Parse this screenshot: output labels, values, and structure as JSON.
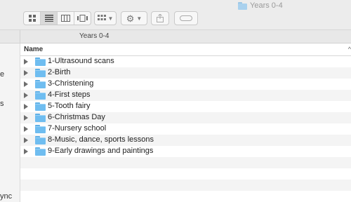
{
  "window": {
    "title": "Years 0-4",
    "title_icon": "folder-icon"
  },
  "toolbar": {
    "view_buttons": [
      {
        "icon": "icon-view-icon",
        "active": false
      },
      {
        "icon": "list-view-icon",
        "active": true
      },
      {
        "icon": "column-view-icon",
        "active": false
      },
      {
        "icon": "cover-flow-icon",
        "active": false
      }
    ],
    "arrange_icon": "arrange-grid-icon",
    "action_icon": "gear-icon",
    "share_icon": "share-icon",
    "tag_icon": "tag-icon"
  },
  "pathbar": {
    "label": "Years 0-4"
  },
  "sidebar": {
    "fragments": [
      "e",
      "s",
      "ync"
    ]
  },
  "list": {
    "column_header": "Name",
    "sort_indicator": "^",
    "items": [
      {
        "name": "1-Ultrasound scans"
      },
      {
        "name": "2-Birth"
      },
      {
        "name": "3-Christening"
      },
      {
        "name": "4-First steps"
      },
      {
        "name": "5-Tooth fairy"
      },
      {
        "name": "6-Christmas Day"
      },
      {
        "name": "7-Nursery school"
      },
      {
        "name": "8-Music, dance, sports lessons"
      },
      {
        "name": "9-Early drawings and paintings"
      }
    ]
  },
  "colors": {
    "folder": "#6fbdf0",
    "toolbar": "#ececec",
    "stripe": "#f4f4f4"
  }
}
